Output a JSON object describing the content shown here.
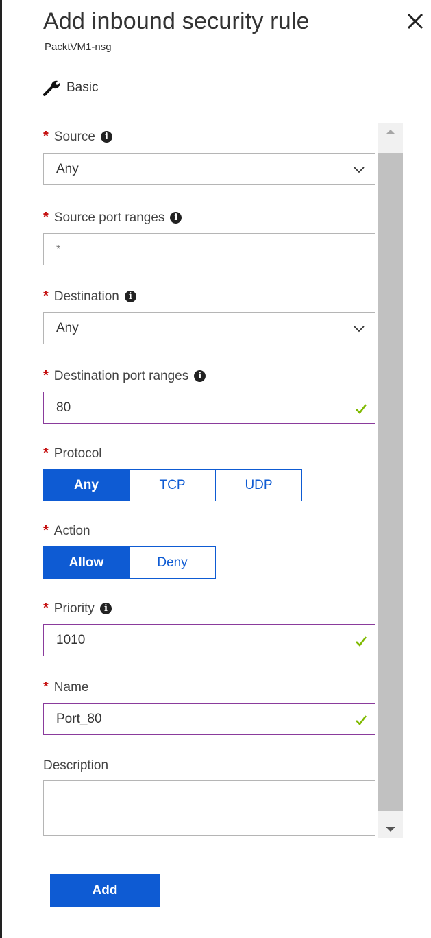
{
  "header": {
    "title": "Add inbound security rule",
    "subtitle": "PacktVM1-nsg",
    "section_tab": "Basic"
  },
  "icons": {
    "close": "close-icon",
    "section": "wrench-icon",
    "info": "info-icon",
    "dropdown": "chevron-down-icon",
    "valid": "checkmark-icon"
  },
  "colors": {
    "accent": "#0e5bd3",
    "required": "#c40b0b",
    "valid_border": "#8a3b9c",
    "valid_check": "#7fba00"
  },
  "form": {
    "source": {
      "label": "Source",
      "value": "Any"
    },
    "source_port_ranges": {
      "label": "Source port ranges",
      "value": "*"
    },
    "destination": {
      "label": "Destination",
      "value": "Any"
    },
    "destination_port_ranges": {
      "label": "Destination port ranges",
      "value": "80"
    },
    "protocol": {
      "label": "Protocol",
      "options": [
        "Any",
        "TCP",
        "UDP"
      ],
      "selected": "Any"
    },
    "action": {
      "label": "Action",
      "options": [
        "Allow",
        "Deny"
      ],
      "selected": "Allow"
    },
    "priority": {
      "label": "Priority",
      "value": "1010"
    },
    "name": {
      "label": "Name",
      "value": "Port_80"
    },
    "description": {
      "label": "Description",
      "value": ""
    }
  },
  "footer": {
    "add_label": "Add"
  }
}
